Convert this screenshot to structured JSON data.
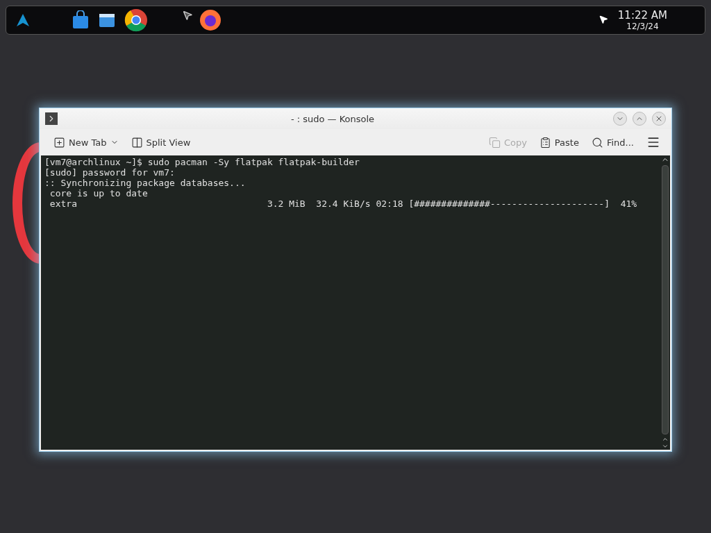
{
  "taskbar": {
    "clock": {
      "time": "11:22 AM",
      "date": "12/3/24"
    }
  },
  "window": {
    "title": "- : sudo — Konsole",
    "toolbar": {
      "left": [
        {
          "kind": "new-tab",
          "label": "New Tab",
          "disabled": false,
          "has_menu": true
        },
        {
          "kind": "split-view",
          "label": "Split View",
          "disabled": false,
          "has_menu": false
        }
      ],
      "right": [
        {
          "kind": "copy",
          "label": "Copy",
          "disabled": true,
          "has_menu": false
        },
        {
          "kind": "paste",
          "label": "Paste",
          "disabled": false,
          "has_menu": false
        },
        {
          "kind": "find",
          "label": "Find...",
          "disabled": false,
          "has_menu": false
        }
      ]
    },
    "terminal": {
      "lines": [
        "[vm7@archlinux ~]$ sudo pacman -Sy flatpak flatpak-builder",
        "[sudo] password for vm7:",
        ":: Synchronizing package databases...",
        " core is up to date",
        " extra                                   3.2 MiB  32.4 KiB/s 02:18 [##############---------------------]  41%"
      ]
    }
  }
}
